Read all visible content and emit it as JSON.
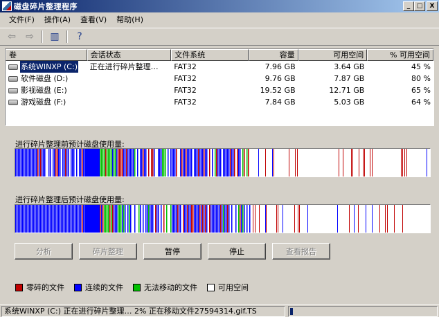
{
  "window": {
    "title": "磁盘碎片整理程序",
    "minimize": "_",
    "maximize": "□",
    "close": "X"
  },
  "menu": [
    "文件(F)",
    "操作(A)",
    "查看(V)",
    "帮助(H)"
  ],
  "toolbar": {
    "back_glyph": "⇦",
    "forward_glyph": "⇨",
    "view_glyph": "▥",
    "help_glyph": "?"
  },
  "table": {
    "columns": [
      "卷",
      "会话状态",
      "文件系统",
      "容量",
      "可用空间",
      "% 可用空间"
    ],
    "rows": [
      {
        "vol": "系统WINXP (C:)",
        "status": "正在进行碎片整理…",
        "fs": "FAT32",
        "cap": "7.96 GB",
        "free": "3.64 GB",
        "pct": "45 %"
      },
      {
        "vol": "软件磁盘 (D:)",
        "status": "",
        "fs": "FAT32",
        "cap": "9.76 GB",
        "free": "7.87 GB",
        "pct": "80 %"
      },
      {
        "vol": "影视磁盘 (E:)",
        "status": "",
        "fs": "FAT32",
        "cap": "19.52 GB",
        "free": "12.71 GB",
        "pct": "65 %"
      },
      {
        "vol": "游戏磁盘 (F:)",
        "status": "",
        "fs": "FAT32",
        "cap": "7.84 GB",
        "free": "5.03 GB",
        "pct": "64 %"
      }
    ]
  },
  "before_label": "进行碎片整理前预计磁盘使用量:",
  "after_label": "进行碎片整理后预计磁盘使用量:",
  "buttons": [
    "分析",
    "碎片整理",
    "暂停",
    "停止",
    "查看报告"
  ],
  "legend": [
    {
      "label": "零碎的文件",
      "color": "#c00000"
    },
    {
      "label": "连续的文件",
      "color": "#0000ff"
    },
    {
      "label": "无法移动的文件",
      "color": "#00c000"
    },
    {
      "label": "可用空间",
      "color": "#ffffff"
    }
  ],
  "status": {
    "text": "系统WINXP (C:) 正在进行碎片整理… 2%  正在移动文件27594314.gif.TS",
    "progress": 0.02
  }
}
